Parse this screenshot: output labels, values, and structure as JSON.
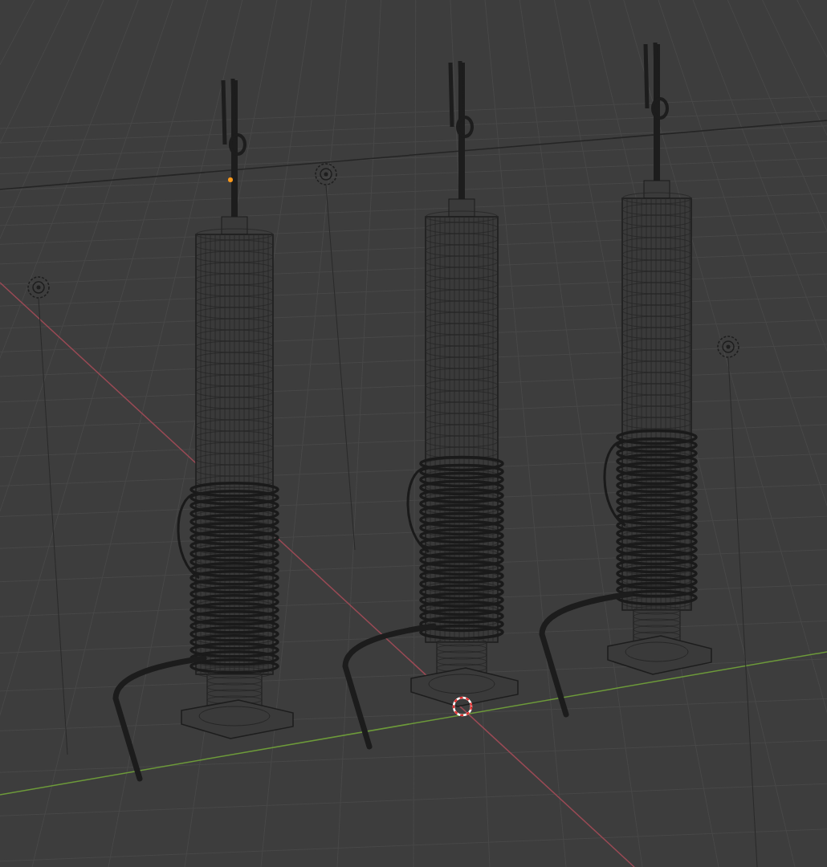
{
  "viewport": {
    "objects": [
      {
        "kind": "arrester",
        "selected": true
      },
      {
        "kind": "arrester",
        "selected": false
      },
      {
        "kind": "arrester",
        "selected": false
      }
    ]
  }
}
